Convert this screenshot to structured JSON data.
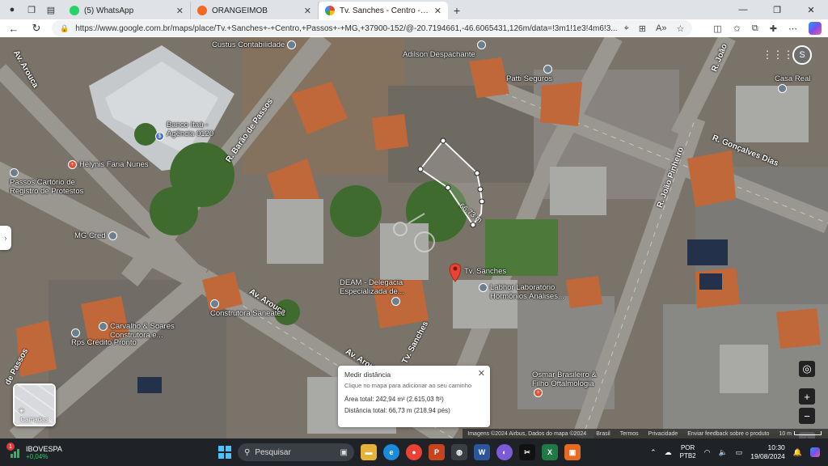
{
  "browser": {
    "tabs": [
      {
        "label": "(5) WhatsApp",
        "favicon": "whatsapp-icon",
        "color": "#25d366",
        "active": false
      },
      {
        "label": "ORANGEIMOB",
        "favicon": "house-icon",
        "color": "#f26722",
        "active": false
      },
      {
        "label": "Tv. Sanches - Centro - Google M",
        "favicon": "maps-pin-icon",
        "color": "#34a853",
        "active": true
      }
    ],
    "url": "https://www.google.com.br/maps/place/Tv.+Sanches+-+Centro,+Passos+-+MG,+37900-152/@-20.7194661,-46.6065431,126m/data=!3m1!1e3!4m6!3..."
  },
  "map": {
    "roads": {
      "arouca_top": "Av. Arouca",
      "barao": "R. Barão de Passos",
      "joao_top": "R. João",
      "goncalves": "R. Gonçalves Dias",
      "joao_pinheiro": "R. João Pinheiro",
      "av_arouca": "Av. Arouca",
      "av_arouca_2": "Av. Arouca",
      "tv_sanches": "Tv. Sanches",
      "de_passos": "de Passos"
    },
    "pois": {
      "custus": "Custus Contabilidade",
      "adilson": "Adilson Despachante",
      "patti": "Patti Seguros",
      "casa_real": "Casa Real",
      "banco_itau": "Banco Itaú -\nAgência 0120",
      "helynis": "Helynis Faria Nunes",
      "cartorio": "Passos Cartório de\nRegistro de Protestos",
      "mg_cred": "MG Cred",
      "tv_sanches": "Tv. Sanches",
      "deam": "DEAM - Delegacia\nEspecializada de...",
      "labhor": "Labhor Laboratório\nHormônios Análises...",
      "carvalho": "Carvalho & Soares\nConstrutora e...",
      "saneatec": "Construtora Saneatec",
      "rps": "Rps Crédito Pronto",
      "osmar": "Osmar Brasileiro &\nFilho Oftalmologia"
    },
    "segment_label": "66,73 m",
    "profile_initial": "S",
    "layers_label": "Camadas",
    "measure": {
      "title": "Medir distância",
      "hint": "Clique no mapa para adicionar ao seu caminho",
      "area": "Área total: 242,94 m² (2.615,03 ft²)",
      "distance": "Distância total: 66,73 m (218,94 pés)"
    },
    "attribution": {
      "imagery": "Imagens ©2024 Airbus, Dados do mapa ©2024",
      "country": "Brasil",
      "terms": "Termos",
      "privacy": "Privacidade",
      "feedback": "Enviar feedback sobre o produto",
      "scale": "10 m"
    }
  },
  "taskbar": {
    "widget_name": "IBOVESPA",
    "widget_change": "+0,04%",
    "widget_badge": "1",
    "search_placeholder": "Pesquisar",
    "lang_line1": "POR",
    "lang_line2": "PTB2",
    "time": "10:30",
    "date": "19/08/2024"
  }
}
